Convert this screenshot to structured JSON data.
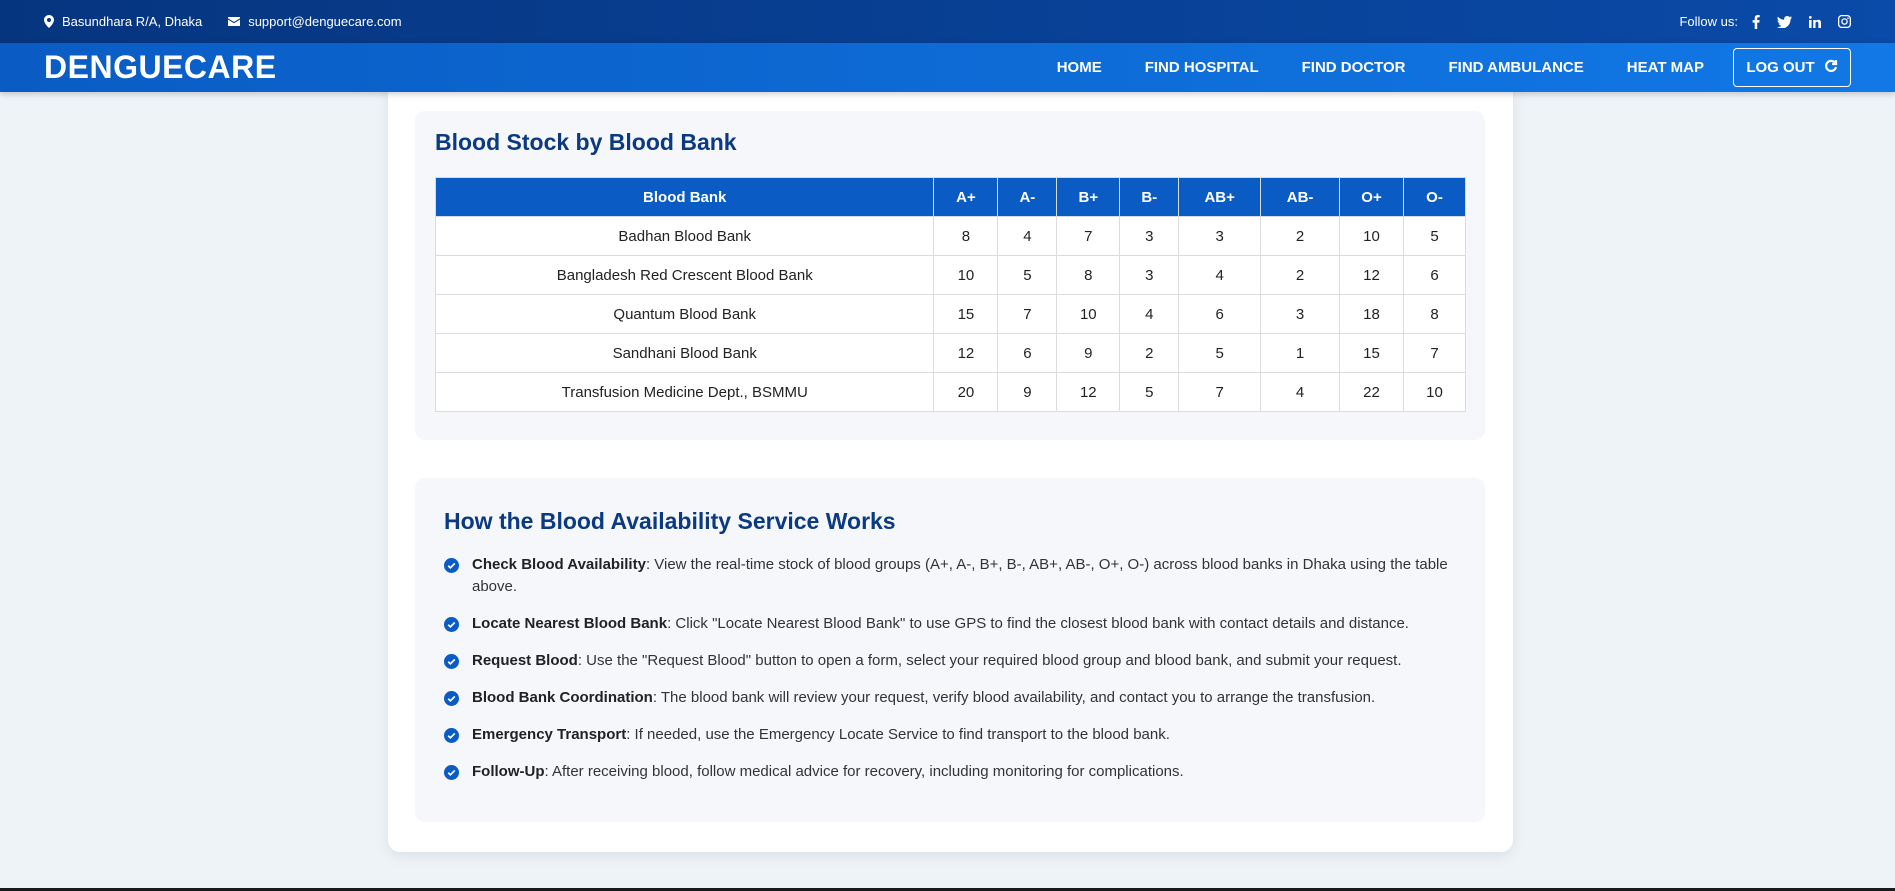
{
  "topbar": {
    "address": "Basundhara R/A, Dhaka",
    "email": "support@denguecare.com",
    "follow_label": "Follow us:",
    "social_icons": [
      "facebook-icon",
      "twitter-icon",
      "linkedin-icon",
      "instagram-icon"
    ]
  },
  "navbar": {
    "brand": "DENGUECARE",
    "links": [
      "HOME",
      "FIND HOSPITAL",
      "FIND DOCTOR",
      "FIND AMBULANCE",
      "HEAT MAP"
    ],
    "logout_label": "LOG OUT"
  },
  "blood_stock": {
    "title": "Blood Stock by Blood Bank",
    "columns": [
      "Blood Bank",
      "A+",
      "A-",
      "B+",
      "B-",
      "AB+",
      "AB-",
      "O+",
      "O-"
    ],
    "rows": [
      [
        "Badhan Blood Bank",
        "8",
        "4",
        "7",
        "3",
        "3",
        "2",
        "10",
        "5"
      ],
      [
        "Bangladesh Red Crescent Blood Bank",
        "10",
        "5",
        "8",
        "3",
        "4",
        "2",
        "12",
        "6"
      ],
      [
        "Quantum Blood Bank",
        "15",
        "7",
        "10",
        "4",
        "6",
        "3",
        "18",
        "8"
      ],
      [
        "Sandhani Blood Bank",
        "12",
        "6",
        "9",
        "2",
        "5",
        "1",
        "15",
        "7"
      ],
      [
        "Transfusion Medicine Dept., BSMMU",
        "20",
        "9",
        "12",
        "5",
        "7",
        "4",
        "22",
        "10"
      ]
    ]
  },
  "how_it_works": {
    "title": "How the Blood Availability Service Works",
    "steps": [
      {
        "label": "Check Blood Availability",
        "text": ": View the real-time stock of blood groups (A+, A-, B+, B-, AB+, AB-, O+, O-) across blood banks in Dhaka using the table above."
      },
      {
        "label": "Locate Nearest Blood Bank",
        "text": ": Click \"Locate Nearest Blood Bank\" to use GPS to find the closest blood bank with contact details and distance."
      },
      {
        "label": "Request Blood",
        "text": ": Use the \"Request Blood\" button to open a form, select your required blood group and blood bank, and submit your request."
      },
      {
        "label": "Blood Bank Coordination",
        "text": ": The blood bank will review your request, verify blood availability, and contact you to arrange the transfusion."
      },
      {
        "label": "Emergency Transport",
        "text": ": If needed, use the Emergency Locate Service to find transport to the blood bank."
      },
      {
        "label": "Follow-Up",
        "text": ": After receiving blood, follow medical advice for recovery, including monitoring for complications."
      }
    ]
  },
  "colors": {
    "primary": "#0a5cc4",
    "topbar": "#06357f",
    "heading": "#0b3a82"
  }
}
